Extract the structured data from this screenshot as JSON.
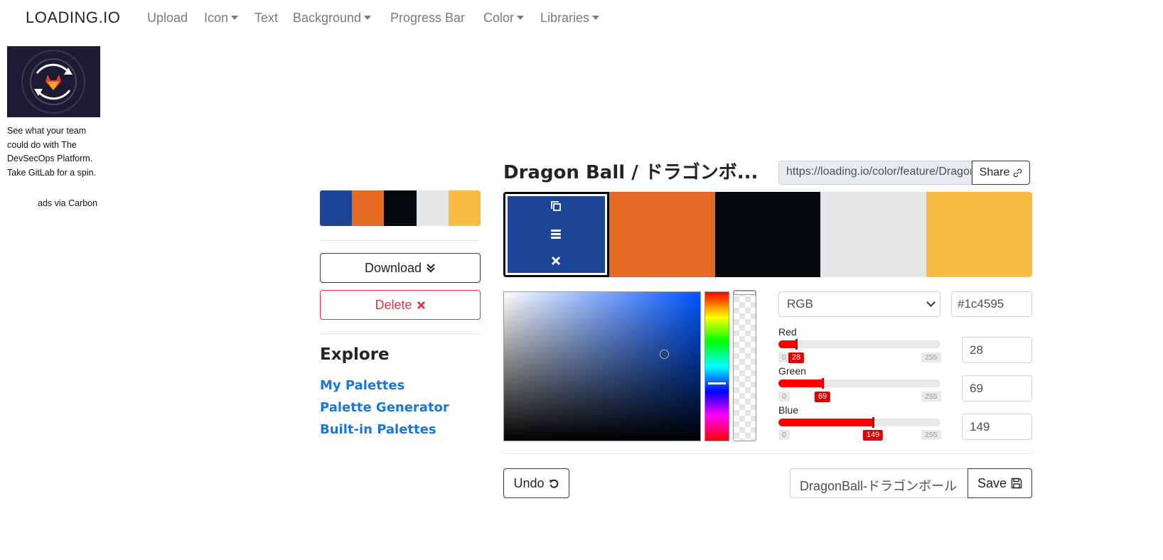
{
  "navbar": {
    "brand": "LOADING.IO",
    "items": [
      {
        "label": "Upload",
        "dropdown": false
      },
      {
        "label": "Icon",
        "dropdown": true
      },
      {
        "label": "Text",
        "dropdown": false
      },
      {
        "label": "Background",
        "dropdown": true
      },
      {
        "label": "Progress Bar",
        "dropdown": false
      },
      {
        "label": "Color",
        "dropdown": true
      },
      {
        "label": "Libraries",
        "dropdown": true
      }
    ]
  },
  "ad": {
    "text": "See what your team could do with The DevSecOps Platform. Take GitLab for a spin.",
    "via": "ads via Carbon"
  },
  "palette": {
    "title": "Dragon Ball / ドラゴンボ...",
    "share_url": "https://loading.io/color/feature/DragonBall",
    "share_label": "Share",
    "colors": [
      "#1c4595",
      "#e56b25",
      "#02080b",
      "#e6e5e7",
      "#f8bc45"
    ],
    "selected_index": 0
  },
  "sidebar": {
    "download_label": "Download",
    "delete_label": "Delete",
    "explore_title": "Explore",
    "links": [
      "My Palettes",
      "Palette Generator",
      "Built-in Palettes"
    ]
  },
  "picker": {
    "mode": "RGB",
    "hex": "#1c4595",
    "channels": [
      {
        "name": "Red",
        "value": "28",
        "min": "0",
        "max": "255",
        "color": "#ff0000"
      },
      {
        "name": "Green",
        "value": "69",
        "min": "0",
        "max": "255",
        "color": "#ff0000"
      },
      {
        "name": "Blue",
        "value": "149",
        "min": "0",
        "max": "255",
        "color": "#ff0000"
      }
    ]
  },
  "footer": {
    "undo_label": "Undo",
    "name_value": "DragonBall-ドラゴンボール",
    "save_label": "Save"
  }
}
